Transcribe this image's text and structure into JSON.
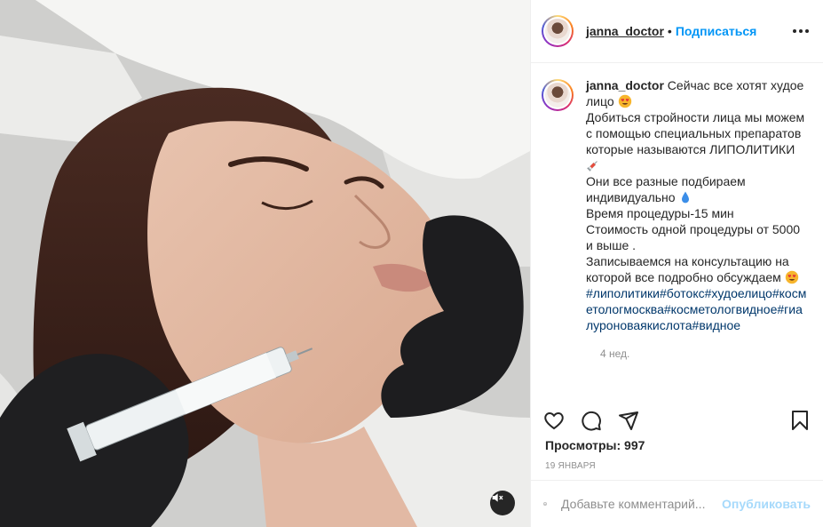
{
  "post": {
    "username": "janna_doctor",
    "separator": "•",
    "follow_label": "Подписаться",
    "caption_lines": [
      "Сейчас все хотят худое лицо",
      "Добиться стройности лица мы можем с помощью специальных препаратов которые называются ЛИПОЛИТИКИ",
      "Они все разные подбираем индивидуально",
      "Время процедуры-15 мин",
      "Стоимость одной процедуры от 5000 и выше .",
      "Записываемся на консультацию на которой все подробно обсуждаем"
    ],
    "hashtags": "#липолитики#ботокс#худоелицо#косметологмосква#косметологвидное#гиалуроноваякислота#видное",
    "time_ago": "4 нед.",
    "views": "Просмотры: 997",
    "date": "19 января"
  },
  "comment_box": {
    "placeholder": "Добавьте комментарий...",
    "publish_label": "Опубликовать"
  },
  "icons": {
    "more": "more-horizontal-icon",
    "like": "heart-icon",
    "comment": "comment-bubble-icon",
    "share": "paper-plane-icon",
    "save": "bookmark-icon",
    "emoji": "smiley-icon",
    "mute": "speaker-muted-icon"
  },
  "colors": {
    "accent": "#0095f6",
    "hashtag": "#00376b",
    "muted_text": "#8e8e8e"
  }
}
